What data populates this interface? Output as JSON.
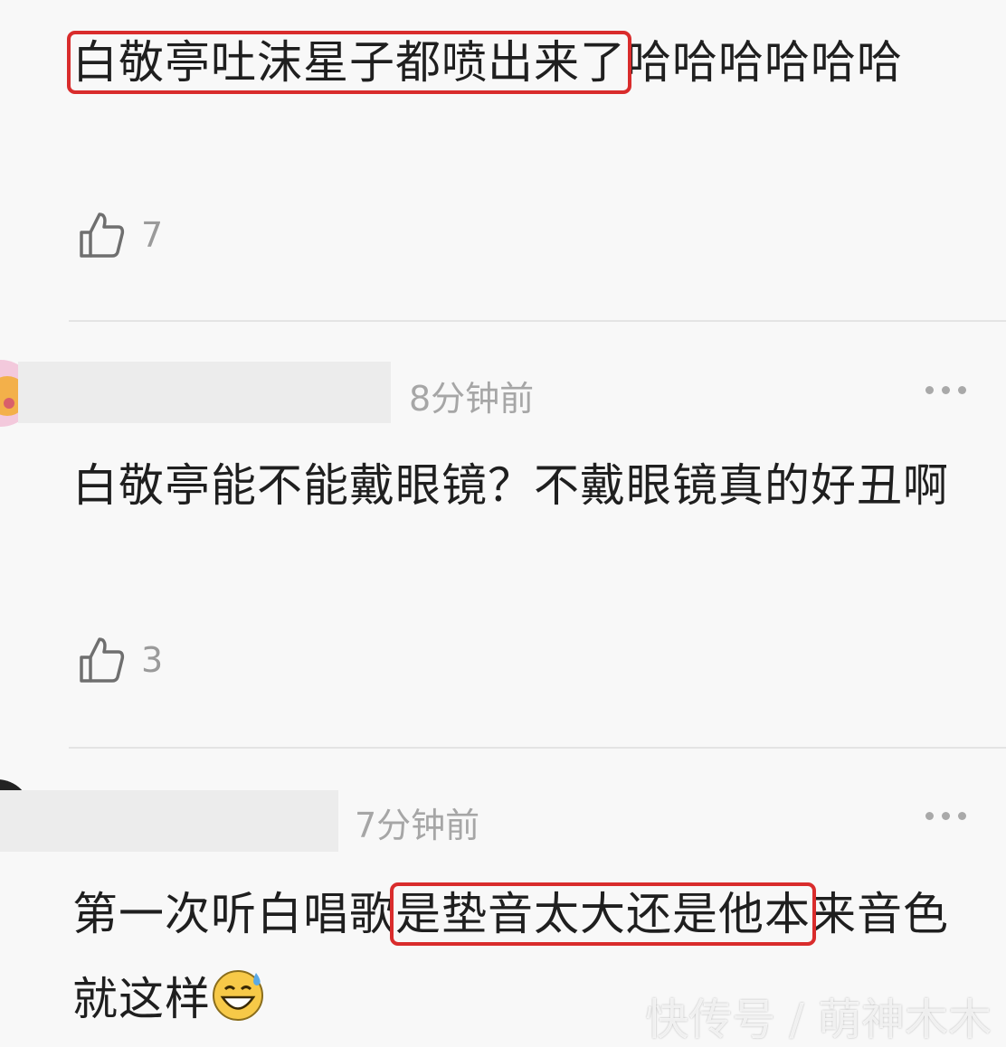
{
  "comments": [
    {
      "highlight": "白敬亭吐沫星子都喷出来了",
      "rest": "哈哈哈哈哈哈",
      "likes": "7"
    },
    {
      "time": "8分钟前",
      "text": "白敬亭能不能戴眼镜？不戴眼镜真的好丑啊",
      "likes": "3"
    },
    {
      "time": "7分钟前",
      "pre": "第一次听白唱歌",
      "highlight": "是垫音太大还是他本",
      "post": "来音色就这样"
    }
  ],
  "watermark": "快传号 / 萌神木木",
  "colors": {
    "highlight_border": "#d92c2c",
    "background": "#f8f8f8"
  }
}
